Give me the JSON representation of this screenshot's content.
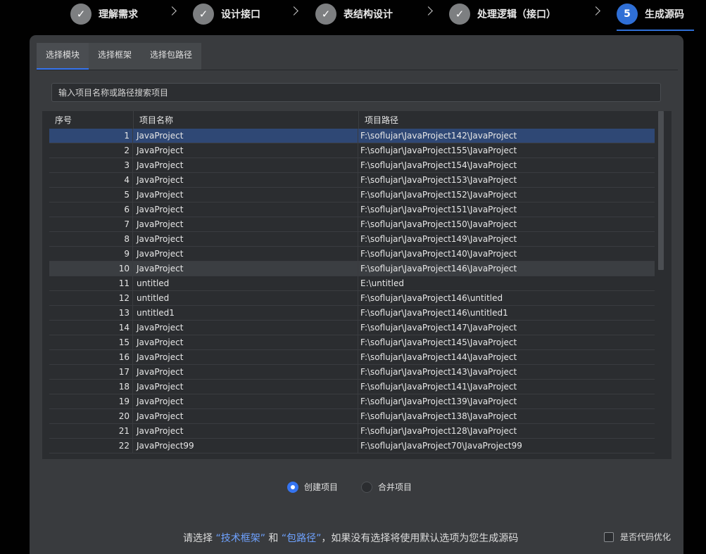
{
  "stepper": {
    "steps": [
      {
        "marker": "✓",
        "label": "理解需求",
        "state": "done"
      },
      {
        "marker": "✓",
        "label": "设计接口",
        "state": "done"
      },
      {
        "marker": "✓",
        "label": "表结构设计",
        "state": "done"
      },
      {
        "marker": "✓",
        "label": "处理逻辑（接口）",
        "state": "done"
      },
      {
        "marker": "5",
        "label": "生成源码",
        "state": "active"
      }
    ]
  },
  "tabs": [
    {
      "label": "选择模块",
      "active": true
    },
    {
      "label": "选择框架",
      "active": false
    },
    {
      "label": "选择包路径",
      "active": false
    }
  ],
  "search": {
    "placeholder": "输入项目名称或路径搜索项目",
    "value": ""
  },
  "table": {
    "headers": [
      "序号",
      "项目名称",
      "项目路径"
    ],
    "rows": [
      {
        "idx": "1",
        "name": "JavaProject",
        "path": "F:\\soflujar\\JavaProject142\\JavaProject"
      },
      {
        "idx": "2",
        "name": "JavaProject",
        "path": "F:\\soflujar\\JavaProject155\\JavaProject"
      },
      {
        "idx": "3",
        "name": "JavaProject",
        "path": "F:\\soflujar\\JavaProject154\\JavaProject"
      },
      {
        "idx": "4",
        "name": "JavaProject",
        "path": "F:\\soflujar\\JavaProject153\\JavaProject"
      },
      {
        "idx": "5",
        "name": "JavaProject",
        "path": "F:\\soflujar\\JavaProject152\\JavaProject"
      },
      {
        "idx": "6",
        "name": "JavaProject",
        "path": "F:\\soflujar\\JavaProject151\\JavaProject"
      },
      {
        "idx": "7",
        "name": "JavaProject",
        "path": "F:\\soflujar\\JavaProject150\\JavaProject"
      },
      {
        "idx": "8",
        "name": "JavaProject",
        "path": "F:\\soflujar\\JavaProject149\\JavaProject"
      },
      {
        "idx": "9",
        "name": "JavaProject",
        "path": "F:\\soflujar\\JavaProject140\\JavaProject"
      },
      {
        "idx": "10",
        "name": "JavaProject",
        "path": "F:\\soflujar\\JavaProject146\\JavaProject"
      },
      {
        "idx": "11",
        "name": "untitled",
        "path": "E:\\untitled"
      },
      {
        "idx": "12",
        "name": "untitled",
        "path": "F:\\soflujar\\JavaProject146\\untitled"
      },
      {
        "idx": "13",
        "name": "untitled1",
        "path": "F:\\soflujar\\JavaProject146\\untitled1"
      },
      {
        "idx": "14",
        "name": "JavaProject",
        "path": "F:\\soflujar\\JavaProject147\\JavaProject"
      },
      {
        "idx": "15",
        "name": "JavaProject",
        "path": "F:\\soflujar\\JavaProject145\\JavaProject"
      },
      {
        "idx": "16",
        "name": "JavaProject",
        "path": "F:\\soflujar\\JavaProject144\\JavaProject"
      },
      {
        "idx": "17",
        "name": "JavaProject",
        "path": "F:\\soflujar\\JavaProject143\\JavaProject"
      },
      {
        "idx": "18",
        "name": "JavaProject",
        "path": "F:\\soflujar\\JavaProject141\\JavaProject"
      },
      {
        "idx": "19",
        "name": "JavaProject",
        "path": "F:\\soflujar\\JavaProject139\\JavaProject"
      },
      {
        "idx": "20",
        "name": "JavaProject",
        "path": "F:\\soflujar\\JavaProject138\\JavaProject"
      },
      {
        "idx": "21",
        "name": "JavaProject",
        "path": "F:\\soflujar\\JavaProject128\\JavaProject"
      },
      {
        "idx": "22",
        "name": "JavaProject99",
        "path": "F:\\soflujar\\JavaProject70\\JavaProject99"
      }
    ],
    "selected_row": "1",
    "hover_row": "10"
  },
  "mode": {
    "options": [
      {
        "label": "创建项目",
        "checked": true
      },
      {
        "label": "合并项目",
        "checked": false
      }
    ]
  },
  "footer": {
    "prefix": "请选择 ",
    "link1": "“技术框架”",
    "mid": " 和 ",
    "link2": "“包路径”",
    "suffix": "，如果没有选择将使用默认选项为您生成源码",
    "checkbox_label": "是否代码优化",
    "checkbox_checked": false
  },
  "colors": {
    "accent": "#3574f0",
    "selected_row": "#2f4875",
    "link": "#6ea2ff"
  }
}
